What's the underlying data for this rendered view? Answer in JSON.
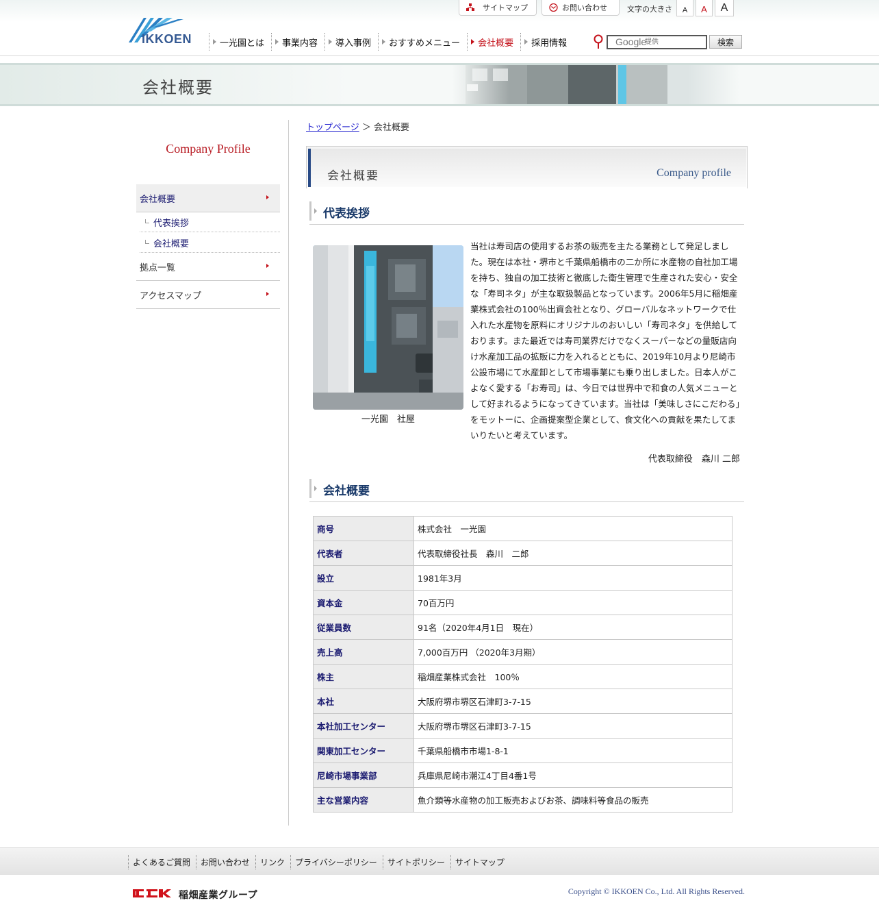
{
  "header": {
    "logo_text": "IKKOEN",
    "sitemap_label": "サイトマップ",
    "contact_label": "お問い合わせ",
    "fontsize_label": "文字の大きさ",
    "fontsize_small": "A",
    "fontsize_medium": "A",
    "fontsize_large": "A",
    "nav": [
      {
        "label": "一光園とは"
      },
      {
        "label": "事業内容"
      },
      {
        "label": "導入事例"
      },
      {
        "label": "おすすめメニュー"
      },
      {
        "label": "会社概要"
      },
      {
        "label": "採用情報"
      }
    ],
    "search": {
      "brand": "Google",
      "placeholder": "提供",
      "button_label": "検索"
    }
  },
  "banner": {
    "title": "会社概要"
  },
  "sidebar": {
    "heading": "Company Profile",
    "items": [
      {
        "label": "会社概要"
      },
      {
        "label": "代表挨拶"
      },
      {
        "label": "会社概要"
      },
      {
        "label": "拠点一覧"
      },
      {
        "label": "アクセスマップ"
      }
    ]
  },
  "breadcrumb": {
    "home": "トップページ",
    "separator": "＞",
    "current": "会社概要"
  },
  "page_header": {
    "title_jp": "会社概要",
    "title_en": "Company profile"
  },
  "greeting": {
    "heading": "代表挨拶",
    "photo_caption": "一光園　社屋",
    "text": "当社は寿司店の使用するお茶の販売を主たる業務として発足しました。現在は本社・堺市と千葉県船橋市の二か所に水産物の自社加工場を持ち、独自の加工技術と徹底した衛生管理で生産された安心・安全な「寿司ネタ」が主な取扱製品となっています。2006年5月に稲畑産業株式会社の100％出資会社となり、グローバルなネットワークで仕入れた水産物を原料にオリジナルのおいしい「寿司ネタ」を供給しております。また最近では寿司業界だけでなくスーパーなどの量販店向け水産加工品の拡販に力を入れるとともに、2019年10月より尼崎市公設市場にて水産卸として市場事業にも乗り出しました。日本人がこよなく愛する「お寿司」は、今日では世界中で和食の人気メニューとして好まれるようになってきています。当社は「美味しさにこだわる」をモットーに、企画提案型企業として、食文化への貢献を果たしてまいりたいと考えています。",
    "signature": "代表取締役　森川 二郎"
  },
  "company": {
    "heading": "会社概要",
    "rows": [
      {
        "key": "商号",
        "value": "株式会社　一光園"
      },
      {
        "key": "代表者",
        "value": "代表取締役社長　森川　二郎"
      },
      {
        "key": "設立",
        "value": "1981年3月"
      },
      {
        "key": "資本金",
        "value": "70百万円"
      },
      {
        "key": "従業員数",
        "value": "91名（2020年4月1日　現在）"
      },
      {
        "key": "売上高",
        "value": "7,000百万円 （2020年3月期）"
      },
      {
        "key": "株主",
        "value": "稲畑産業株式会社　100％"
      },
      {
        "key": "本社",
        "value": "大阪府堺市堺区石津町3-7-15"
      },
      {
        "key": "本社加工センター",
        "value": "大阪府堺市堺区石津町3-7-15"
      },
      {
        "key": "関東加工センター",
        "value": "千葉県船橋市市場1-8-1"
      },
      {
        "key": "尼崎市場事業部",
        "value": "兵庫県尼崎市潮江4丁目4番1号"
      },
      {
        "key": "主な営業内容",
        "value": "魚介類等水産物の加工販売およびお茶、調味料等食品の販売"
      }
    ]
  },
  "footer": {
    "links": [
      {
        "label": "よくあるご質問"
      },
      {
        "label": "お問い合わせ"
      },
      {
        "label": "リンク"
      },
      {
        "label": "プライバシーポリシー"
      },
      {
        "label": "サイトポリシー"
      },
      {
        "label": "サイトマップ"
      }
    ],
    "group_name": "稲畑産業グループ",
    "copyright": "Copyright  ©  IKKOEN Co., Ltd.  All Rights Reserved."
  },
  "colors": {
    "accent_red": "#c4121b",
    "navy": "#1a3a6a",
    "logo_blue": "#355a93"
  }
}
